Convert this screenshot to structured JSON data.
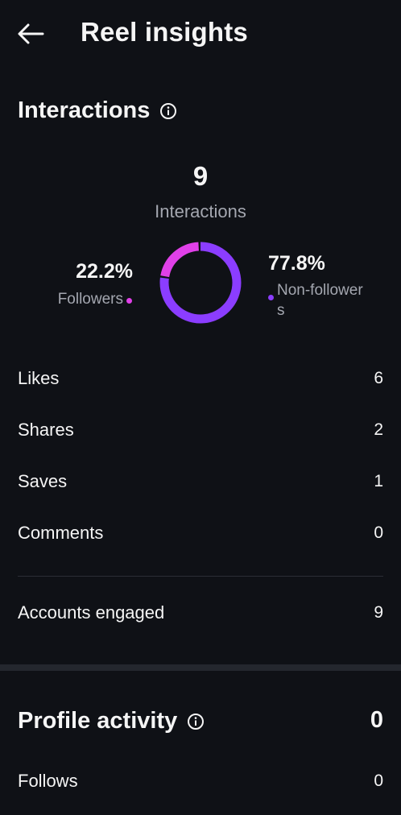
{
  "header": {
    "title": "Reel insights"
  },
  "interactions": {
    "section_title": "Interactions",
    "total": "9",
    "total_label": "Interactions",
    "followers_pct": "22.2%",
    "followers_label": "Followers",
    "nonfollowers_pct": "77.8%",
    "nonfollowers_label": "Non-followers",
    "followers_fraction": 0.222,
    "colors": {
      "followers": "#e040e8",
      "non_followers": "#8b3dff"
    }
  },
  "metrics": [
    {
      "label": "Likes",
      "value": "6"
    },
    {
      "label": "Shares",
      "value": "2"
    },
    {
      "label": "Saves",
      "value": "1"
    },
    {
      "label": "Comments",
      "value": "0"
    }
  ],
  "accounts_engaged": {
    "label": "Accounts engaged",
    "value": "9"
  },
  "profile_activity": {
    "section_title": "Profile activity",
    "value": "0",
    "rows": [
      {
        "label": "Follows",
        "value": "0"
      }
    ]
  },
  "icons": {
    "back": "back-arrow-icon",
    "info": "info-icon"
  }
}
